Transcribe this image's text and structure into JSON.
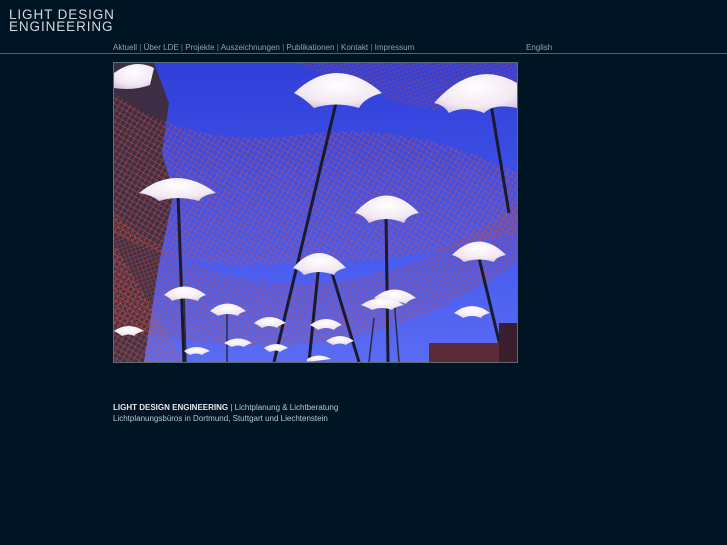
{
  "logo": {
    "line1": "LIGHT DESIGN",
    "line2": "ENGINEERING"
  },
  "nav": {
    "items": [
      {
        "label": "Aktuell"
      },
      {
        "label": "Über LDE"
      },
      {
        "label": "Projekte"
      },
      {
        "label": "Auszeichnungen"
      },
      {
        "label": "Publikationen"
      },
      {
        "label": "Kontakt"
      },
      {
        "label": "Impressum"
      }
    ],
    "separator": "|"
  },
  "language": {
    "label": "English"
  },
  "footer": {
    "company": "LIGHT DESIGN ENGINEERING",
    "tagline": " | Lichtplanung & Lichtberatung",
    "line2": "Lichtplanungsbüros in Dortmund, Stuttgart und Liechtenstein"
  },
  "colors": {
    "background": "#001524",
    "nav_text": "#8fa2ae",
    "sky": "#3d4fe6",
    "net": "#c84a3c"
  }
}
